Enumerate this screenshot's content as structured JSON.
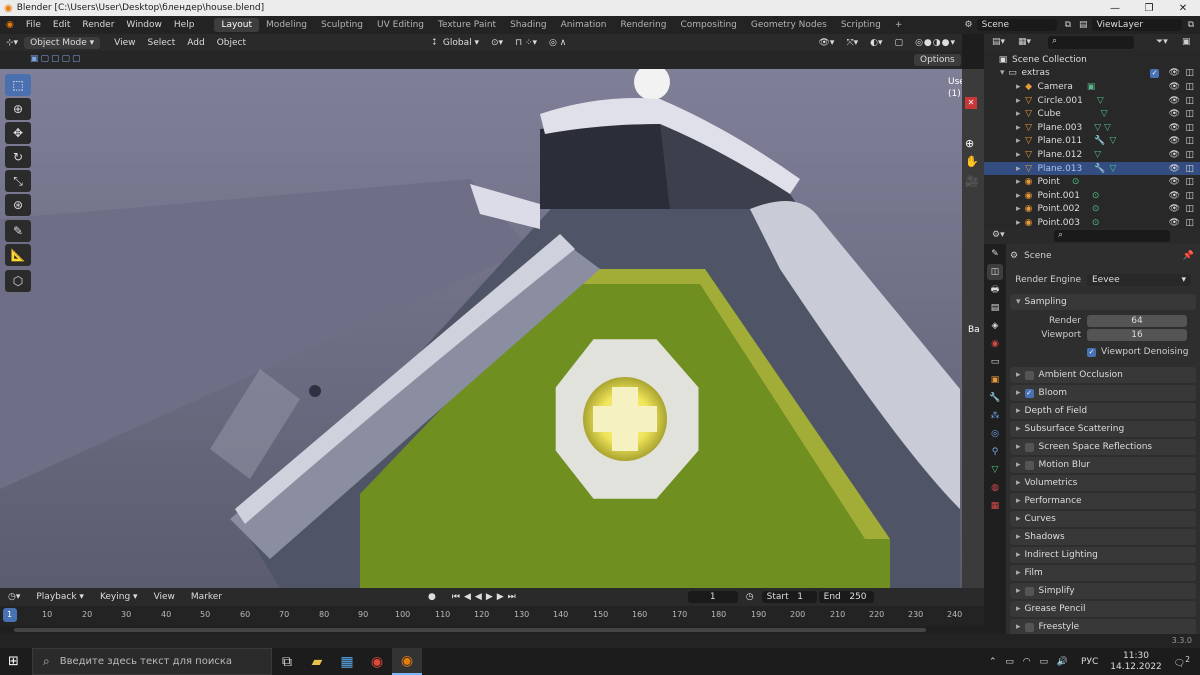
{
  "window": {
    "title": "Blender [C:\\Users\\User\\Desktop\\блендер\\house.blend]"
  },
  "menu": {
    "items": [
      "File",
      "Edit",
      "Render",
      "Window",
      "Help"
    ]
  },
  "workspaces": [
    {
      "label": "Layout",
      "active": true
    },
    {
      "label": "Modeling"
    },
    {
      "label": "Sculpting"
    },
    {
      "label": "UV Editing"
    },
    {
      "label": "Texture Paint"
    },
    {
      "label": "Shading"
    },
    {
      "label": "Animation"
    },
    {
      "label": "Rendering"
    },
    {
      "label": "Compositing"
    },
    {
      "label": "Geometry Nodes"
    },
    {
      "label": "Scripting"
    }
  ],
  "scene_field": "Scene",
  "viewlayer_field": "ViewLayer",
  "viewport_header": {
    "mode": "Object Mode",
    "menus": [
      "View",
      "Select",
      "Add",
      "Object"
    ],
    "transform_orientation": "Global",
    "options_label": "Options"
  },
  "viewport_overlay": {
    "collection_partial": "Use",
    "frame_partial": "(1)",
    "bake_partial": "Ba"
  },
  "timeline": {
    "menus": [
      "Playback",
      "Keying",
      "View",
      "Marker"
    ],
    "current_frame": "1",
    "start_label": "Start",
    "start": "1",
    "end_label": "End",
    "end": "250",
    "ruler": [
      "1",
      "10",
      "20",
      "30",
      "40",
      "50",
      "60",
      "70",
      "80",
      "90",
      "100",
      "110",
      "120",
      "130",
      "140",
      "150",
      "160",
      "170",
      "180",
      "190",
      "200",
      "210",
      "220",
      "230",
      "240"
    ]
  },
  "outliner": {
    "rows": [
      {
        "name": "Scene Collection",
        "kind": "scene"
      },
      {
        "name": "extras",
        "kind": "collection"
      },
      {
        "name": "Camera",
        "kind": "camera"
      },
      {
        "name": "Circle.001",
        "kind": "mesh"
      },
      {
        "name": "Cube",
        "kind": "mesh"
      },
      {
        "name": "Plane.003",
        "kind": "mesh"
      },
      {
        "name": "Plane.011",
        "kind": "mesh"
      },
      {
        "name": "Plane.012",
        "kind": "mesh"
      },
      {
        "name": "Plane.013",
        "kind": "mesh",
        "selected": true
      },
      {
        "name": "Point",
        "kind": "light"
      },
      {
        "name": "Point.001",
        "kind": "light"
      },
      {
        "name": "Point.002",
        "kind": "light"
      },
      {
        "name": "Point.003",
        "kind": "light"
      }
    ]
  },
  "properties": {
    "scene_label": "Scene",
    "render_engine_label": "Render Engine",
    "render_engine": "Eevee",
    "sampling": {
      "label": "Sampling",
      "render_label": "Render",
      "render": "64",
      "viewport_label": "Viewport",
      "viewport": "16",
      "denoise_label": "Viewport Denoising"
    },
    "panels": [
      {
        "label": "Ambient Occlusion",
        "checkbox": true,
        "checked": false
      },
      {
        "label": "Bloom",
        "checkbox": true,
        "checked": true
      },
      {
        "label": "Depth of Field"
      },
      {
        "label": "Subsurface Scattering"
      },
      {
        "label": "Screen Space Reflections",
        "checkbox": true,
        "checked": false
      },
      {
        "label": "Motion Blur",
        "checkbox": true,
        "checked": false
      },
      {
        "label": "Volumetrics"
      },
      {
        "label": "Performance"
      },
      {
        "label": "Curves"
      },
      {
        "label": "Shadows"
      },
      {
        "label": "Indirect Lighting"
      },
      {
        "label": "Film"
      },
      {
        "label": "Simplify",
        "checkbox": true,
        "checked": false
      },
      {
        "label": "Grease Pencil"
      },
      {
        "label": "Freestyle",
        "checkbox": true,
        "checked": false
      }
    ]
  },
  "status": {
    "version": "3.3.0"
  },
  "taskbar": {
    "search_placeholder": "Введите здесь текст для поиска",
    "lang": "РУС",
    "time": "11:30",
    "date": "14.12.2022",
    "notifications": "2"
  },
  "colors": {
    "accent": "#4772b3",
    "selected_row": "#334d80",
    "window_green": "#6f8f20",
    "glow": "#f3e65a"
  }
}
